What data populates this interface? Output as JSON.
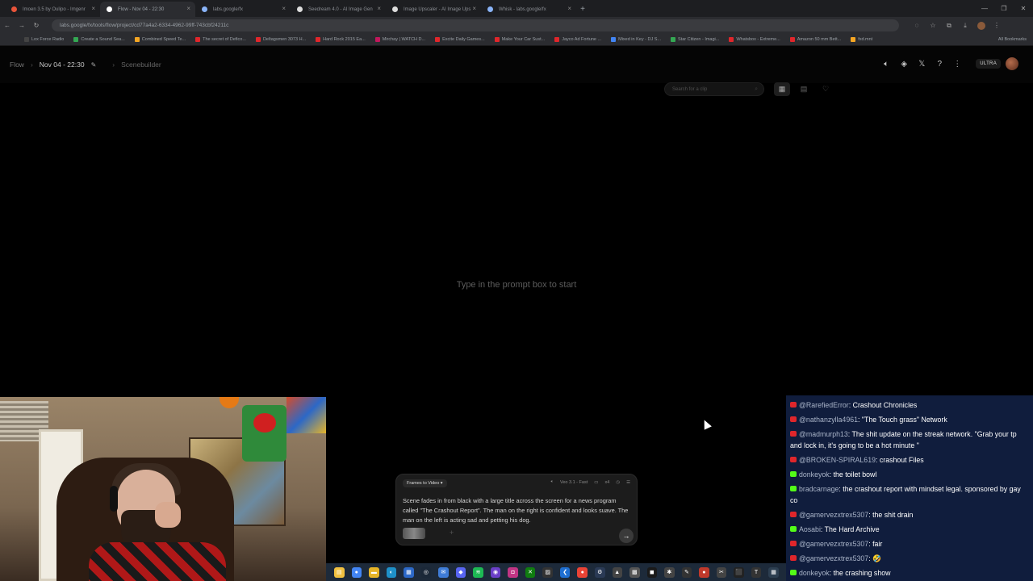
{
  "browser": {
    "tabs": [
      {
        "label": "Imoen 3.5 by Oulipo - Imgenr",
        "favicon_color": "#e8543a",
        "active": false
      },
      {
        "label": "Flow - Nov 04 - 22:30",
        "favicon_color": "#ffffff",
        "active": true
      },
      {
        "label": "labs.google/fx",
        "favicon_color": "#8ab4f8",
        "active": false
      },
      {
        "label": "Seedream 4.0 - AI Image Gen",
        "favicon_color": "#dddddd",
        "active": false
      },
      {
        "label": "Image Upscaler - AI Image Ups",
        "favicon_color": "#dddddd",
        "active": false
      },
      {
        "label": "Whisk - labs.google/fx",
        "favicon_color": "#8ab4f8",
        "active": false
      }
    ],
    "new_tab": "+",
    "window_controls": [
      "—",
      "❐",
      "✕"
    ],
    "url": "labs.google/fx/tools/flow/project/cd77a4a2-6334-4962-99ff-743cbf24211c",
    "bookmarks": [
      {
        "label": "Lox Force Radio",
        "color": "#444444"
      },
      {
        "label": "Create a Sound Sea...",
        "color": "#34a853"
      },
      {
        "label": "Combined Speed Te...",
        "color": "#f5a623"
      },
      {
        "label": "The secret of Defico...",
        "color": "#e0262b"
      },
      {
        "label": "Deltagsmen 3073 H...",
        "color": "#e0262b"
      },
      {
        "label": "Hard Rock 2015 Ea...",
        "color": "#e0262b"
      },
      {
        "label": "Mirchay | WATCH D...",
        "color": "#c2185b"
      },
      {
        "label": "Excite Daily Games...",
        "color": "#e0262b"
      },
      {
        "label": "Make Your Car Sust...",
        "color": "#e0262b"
      },
      {
        "label": "Jayco Ad Fortune ...",
        "color": "#e0262b"
      },
      {
        "label": "Mixed in Key - DJ S...",
        "color": "#4285f4"
      },
      {
        "label": "Star Citizen - Imagi...",
        "color": "#34a853"
      },
      {
        "label": "Whatsbox - Extreme...",
        "color": "#e0262b"
      },
      {
        "label": "Amazon 50 mm Bett...",
        "color": "#e0262b"
      },
      {
        "label": "fxd.mnt",
        "color": "#f5a623"
      }
    ],
    "all_bookmarks": "All Bookmarks"
  },
  "app": {
    "breadcrumb": {
      "root": "Flow",
      "project": "Nov 04 - 22:30",
      "scene": "Scenebuilder"
    },
    "plan_badge": "ULTRA",
    "search_placeholder": "Search for a clip",
    "empty_message": "Type in the prompt box to start"
  },
  "prompt": {
    "mode": "Frames to Video",
    "model": "Veo 3.1 - Fast",
    "count": "x4",
    "text": "Scene fades in from black with a large title across the screen for a news program called \"The Crashout Report\". The man on the right is confident and looks suave. The man on the left is acting sad and petting his dog."
  },
  "chat": {
    "messages": [
      {
        "platform": "youtube",
        "user": "@RarefiedError",
        "text": "Crashout Chronicles"
      },
      {
        "platform": "youtube",
        "user": "@nathanzylla4961",
        "text": "\"The Touch grass\" Network"
      },
      {
        "platform": "youtube",
        "user": "@madmurph13",
        "text": "The shit update on the streak network. \"Grab your tp and lock in, it's going to be a hot minute \""
      },
      {
        "platform": "youtube",
        "user": "@BROKEN-SPIRAL619",
        "text": "crashout Files"
      },
      {
        "platform": "kick",
        "user": "donkeyok",
        "text": "the toilet bowl"
      },
      {
        "platform": "kick",
        "user": "bradcarnage",
        "text": "the crashout report with mindset legal. sponsored by gay co"
      },
      {
        "platform": "youtube",
        "user": "@gamervezxtrex5307",
        "text": "the shit drain"
      },
      {
        "platform": "kick",
        "user": "Aosabi",
        "text": "The Hard Archive"
      },
      {
        "platform": "youtube",
        "user": "@gamervezxtrex5307",
        "text": "fair"
      },
      {
        "platform": "youtube",
        "user": "@gamervezxtrex5307",
        "text": "🤣"
      },
      {
        "platform": "kick",
        "user": "donkeyok",
        "text": "the crashing show"
      }
    ]
  },
  "taskbar": {
    "icons": [
      {
        "name": "file-explorer",
        "color": "#f0c040",
        "glyph": "▤"
      },
      {
        "name": "chrome",
        "color": "#4285f4",
        "glyph": "●"
      },
      {
        "name": "folder",
        "color": "#e6b428",
        "glyph": "▬"
      },
      {
        "name": "edge",
        "color": "#1e90c8",
        "glyph": "◐"
      },
      {
        "name": "store",
        "color": "#2c68c7",
        "glyph": "▦"
      },
      {
        "name": "steam",
        "color": "#1b2838",
        "glyph": "◎"
      },
      {
        "name": "mail",
        "color": "#3f7cd6",
        "glyph": "✉"
      },
      {
        "name": "discord",
        "color": "#5865f2",
        "glyph": "◆"
      },
      {
        "name": "spotify",
        "color": "#1db954",
        "glyph": "≋"
      },
      {
        "name": "obs",
        "color": "#6a3fc8",
        "glyph": "◉"
      },
      {
        "name": "instagram",
        "color": "#c13584",
        "glyph": "◘"
      },
      {
        "name": "xbox",
        "color": "#107c10",
        "glyph": "✕"
      },
      {
        "name": "app",
        "color": "#333333",
        "glyph": "▨"
      },
      {
        "name": "vs-code",
        "color": "#1f6fd1",
        "glyph": "❮"
      },
      {
        "name": "chrome-alt",
        "color": "#ea4335",
        "glyph": "●"
      },
      {
        "name": "app",
        "color": "#2a3a55",
        "glyph": "⚙"
      },
      {
        "name": "app",
        "color": "#444444",
        "glyph": "▲"
      },
      {
        "name": "app",
        "color": "#555555",
        "glyph": "▩"
      },
      {
        "name": "app",
        "color": "#1a1a1a",
        "glyph": "◼"
      },
      {
        "name": "app",
        "color": "#444444",
        "glyph": "✱"
      },
      {
        "name": "app",
        "color": "#333333",
        "glyph": "✎"
      },
      {
        "name": "app",
        "color": "#c0392b",
        "glyph": "●"
      },
      {
        "name": "app",
        "color": "#444444",
        "glyph": "✂"
      },
      {
        "name": "app",
        "color": "#222222",
        "glyph": "⬛"
      },
      {
        "name": "app",
        "color": "#333333",
        "glyph": "T"
      },
      {
        "name": "app",
        "color": "#2c3e50",
        "glyph": "▦"
      }
    ]
  }
}
